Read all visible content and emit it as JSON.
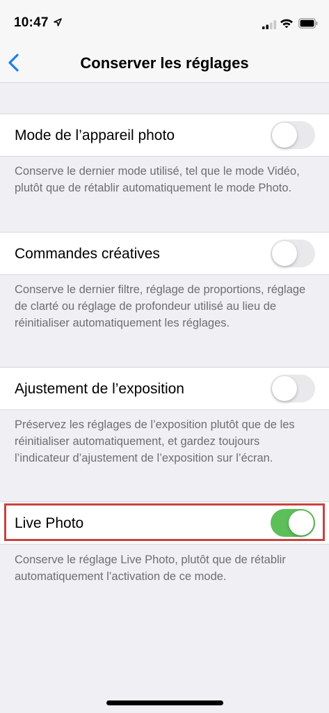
{
  "status_bar": {
    "time": "10:47",
    "icons": [
      "location-arrow-icon",
      "cellular-signal-icon",
      "wifi-icon",
      "battery-icon"
    ]
  },
  "nav": {
    "back_icon": "chevron-left-icon",
    "title": "Conserver les réglages"
  },
  "settings": [
    {
      "label": "Mode de l’appareil photo",
      "enabled": false,
      "footer": "Conserve le dernier mode utilisé, tel que le mode Vidéo, plutôt que de rétablir automatiquement le mode Photo."
    },
    {
      "label": "Commandes créatives",
      "enabled": false,
      "footer": "Conserve le dernier filtre, réglage de proportions, réglage de clarté ou réglage de profondeur utilisé au lieu de réinitialiser automatiquement les réglages."
    },
    {
      "label": "Ajustement de l’exposition",
      "enabled": false,
      "footer": "Préservez les réglages de l’exposition plutôt que de les réinitialiser automatiquement, et gardez toujours l’indicateur d’ajustement de l’exposition sur l’écran."
    },
    {
      "label": "Live Photo",
      "enabled": true,
      "footer": "Conserve le réglage Live Photo, plutôt que de rétablir automatiquement l’activation de ce mode."
    }
  ],
  "colors": {
    "accent": "#1a7ef5",
    "switch_on": "#5dbf5a",
    "switch_off": "#e9e9eb",
    "highlight_border": "#c8433d",
    "background": "#efeff4"
  }
}
